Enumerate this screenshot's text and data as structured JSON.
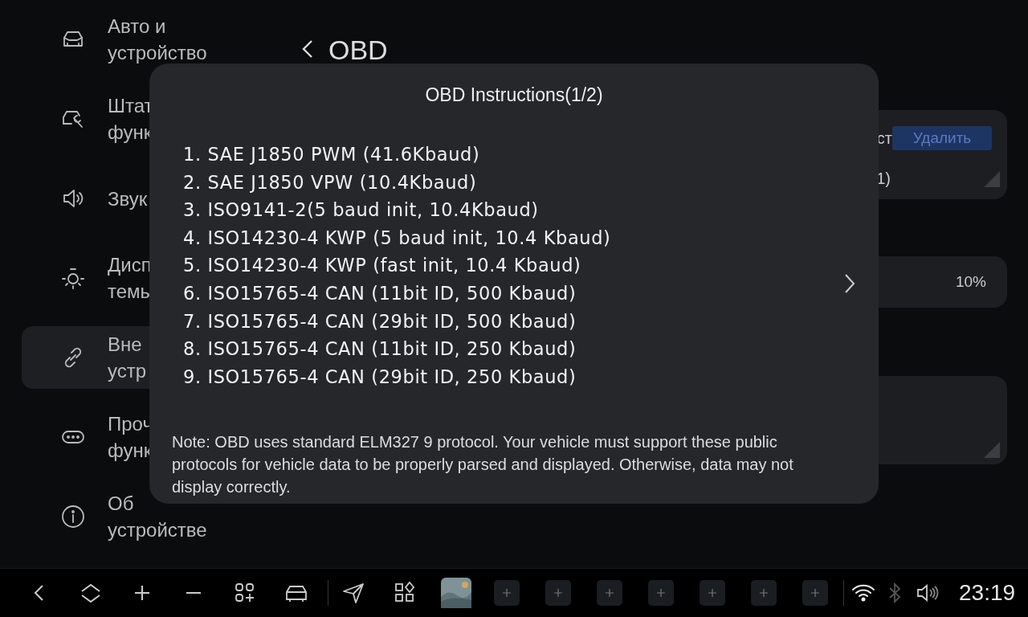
{
  "sidebar": {
    "items": [
      {
        "lines": [
          "Авто и",
          "устройство"
        ],
        "selected": false
      },
      {
        "lines": [
          "Штат",
          "функ"
        ],
        "selected": false
      },
      {
        "lines": [
          "Звук"
        ],
        "selected": false
      },
      {
        "lines": [
          "Дисп",
          "темы"
        ],
        "selected": false
      },
      {
        "lines": [
          "Вне",
          "устр"
        ],
        "selected": true
      },
      {
        "lines": [
          "Проч",
          "функ"
        ],
        "selected": false
      },
      {
        "lines": [
          "Об",
          "устройстве"
        ],
        "selected": false
      }
    ]
  },
  "header": {
    "title": "OBD"
  },
  "cards": [
    {
      "text": "ст",
      "button": "Удалить",
      "detail": "1)"
    },
    {
      "value": "10%"
    }
  ],
  "dialog": {
    "title": "OBD Instructions(1/2)",
    "protocols": [
      "1. SAE J1850 PWM (41.6Kbaud)",
      "2. SAE J1850 VPW (10.4Kbaud)",
      "3. ISO9141-2(5 baud init, 10.4Kbaud)",
      "4. ISO14230-4 KWP (5 baud init, 10.4 Kbaud)",
      "5. ISO14230-4 KWP (fast init, 10.4 Kbaud)",
      "6. ISO15765-4 CAN (11bit ID, 500 Kbaud)",
      "7. ISO15765-4 CAN (29bit ID, 500 Kbaud)",
      "8. ISO15765-4 CAN (11bit ID, 250 Kbaud)",
      "9. ISO15765-4 CAN (29bit ID, 250 Kbaud)"
    ],
    "note": "Note: OBD uses standard ELM327 9 protocol. Your vehicle must support these public protocols for vehicle data to be properly parsed and displayed. Otherwise, data may not display correctly."
  },
  "status_bar": {
    "bluetooth": {
      "on": false
    },
    "time": "23:19"
  }
}
